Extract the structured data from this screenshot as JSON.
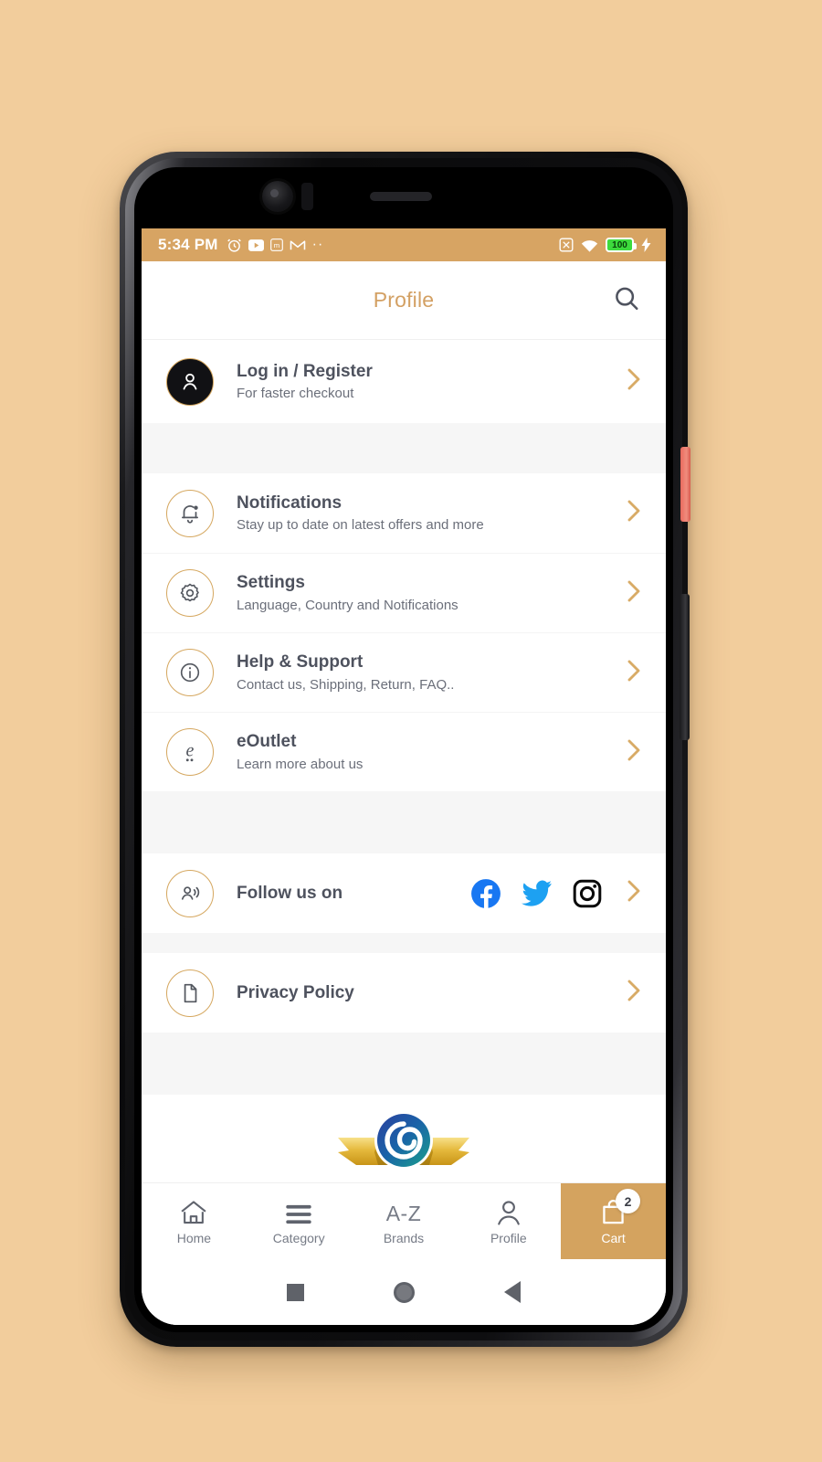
{
  "statusbar": {
    "time": "5:34 PM",
    "left_icons": [
      "alarm-icon",
      "youtube-icon",
      "m-app-icon",
      "gmail-icon",
      "overflow-dots-icon"
    ],
    "overflow_dots": "··",
    "right_icons": [
      "no-sim-icon",
      "wifi-icon",
      "battery-icon",
      "charging-bolt-icon"
    ],
    "battery_level": "100"
  },
  "header": {
    "title": "Profile",
    "search_icon": "search-icon",
    "title_color": "#d3a063"
  },
  "account": {
    "title": "Log in / Register",
    "subtitle": "For faster checkout",
    "icon": "user-avatar-icon"
  },
  "menu": [
    {
      "title": "Notifications",
      "subtitle": "Stay up to date on latest offers and more",
      "icon": "bell-icon"
    },
    {
      "title": "Settings",
      "subtitle": "Language, Country and Notifications",
      "icon": "gear-icon"
    },
    {
      "title": "Help & Support",
      "subtitle": "Contact us, Shipping, Return, FAQ..",
      "icon": "info-circle-icon"
    },
    {
      "title": "eOutlet",
      "subtitle": "Learn more about us",
      "icon": "eoutlet-logo-icon"
    }
  ],
  "follow": {
    "title": "Follow us on",
    "icon": "person-broadcast-icon",
    "socials": [
      "facebook-icon",
      "twitter-icon",
      "instagram-icon"
    ]
  },
  "privacy": {
    "title": "Privacy Policy",
    "icon": "document-icon"
  },
  "brand_badge": {
    "name": "eoutlet-award-badge",
    "ribbon_color": "#e0b63a",
    "emblem_colors": [
      "#1d4f9e",
      "#17a090"
    ]
  },
  "bottom_nav": {
    "items": [
      {
        "label": "Home",
        "icon": "home-icon",
        "active": false
      },
      {
        "label": "Category",
        "icon": "hamburger-icon",
        "active": false
      },
      {
        "label": "Brands",
        "icon": "a-z-icon",
        "icon_text": "A-Z",
        "active": false
      },
      {
        "label": "Profile",
        "icon": "person-icon",
        "active": false
      },
      {
        "label": "Cart",
        "icon": "shopping-bag-icon",
        "active": true,
        "badge": "2"
      }
    ],
    "active_color": "#d4a35f"
  },
  "system_nav": {
    "recents": "square-recents-icon",
    "home": "circle-home-icon",
    "back": "triangle-back-icon"
  },
  "theme": {
    "page_background": "#f2cd9c",
    "accent_gold": "#d4a35f",
    "statusbar_gold": "#d7a463",
    "text_dark": "#4e525e",
    "text_muted": "#6b6f7a"
  }
}
